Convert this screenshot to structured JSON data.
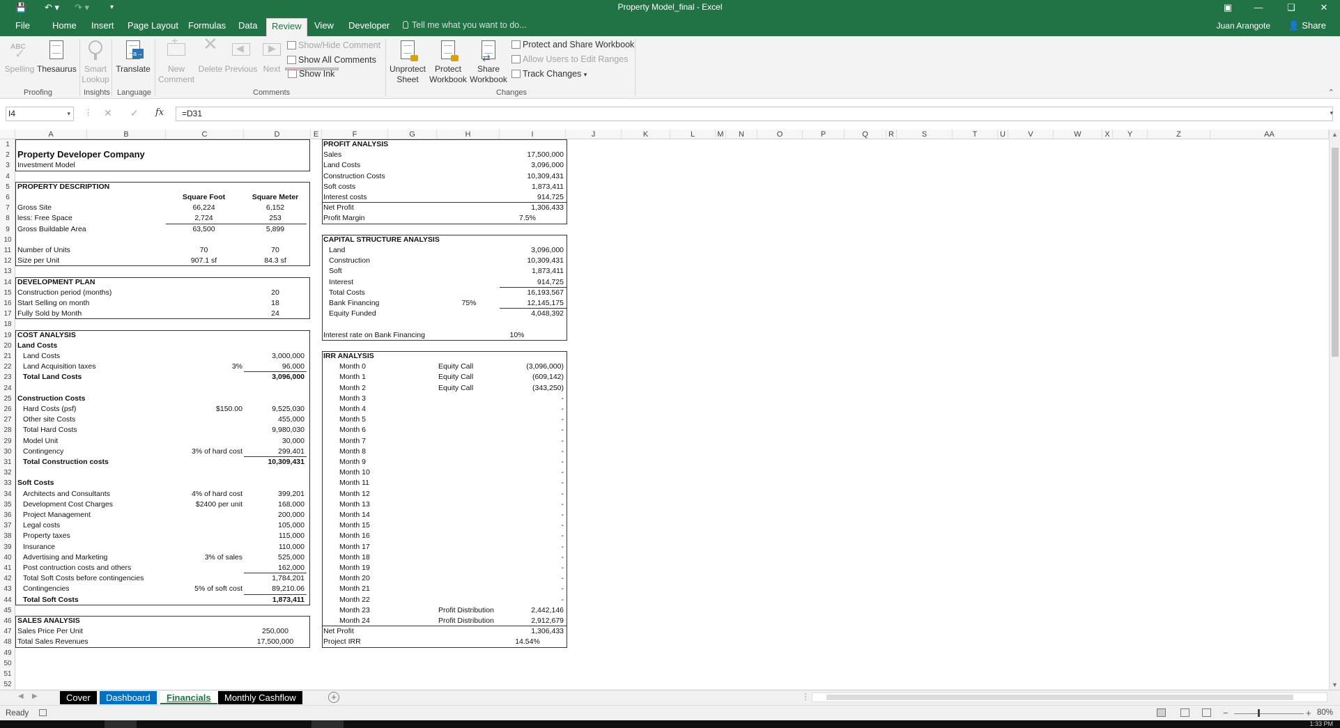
{
  "window": {
    "title": "Property Model_final - Excel",
    "user": "Juan Arangote",
    "share_label": "Share"
  },
  "ribbon_tabs": [
    "File",
    "Home",
    "Insert",
    "Page Layout",
    "Formulas",
    "Data",
    "Review",
    "View",
    "Developer"
  ],
  "active_tab": "Review",
  "tell_me_placeholder": "Tell me what you want to do...",
  "ribbon": {
    "spelling": "Spelling",
    "thesaurus": "Thesaurus",
    "smart_lookup_1": "Smart",
    "smart_lookup_2": "Lookup",
    "translate": "Translate",
    "new_comment_1": "New",
    "new_comment_2": "Comment",
    "delete": "Delete",
    "previous": "Previous",
    "next": "Next",
    "show_hide_comment": "Show/Hide Comment",
    "show_all_comments": "Show All Comments",
    "show_ink": "Show Ink",
    "unprotect_1": "Unprotect",
    "unprotect_2": "Sheet",
    "protect_wb_1": "Protect",
    "protect_wb_2": "Workbook",
    "share_wb_1": "Share",
    "share_wb_2": "Workbook",
    "protect_share": "Protect and Share Workbook",
    "allow_users": "Allow Users to Edit Ranges",
    "track_changes": "Track Changes",
    "groups": {
      "proofing": "Proofing",
      "insights": "Insights",
      "language": "Language",
      "comments": "Comments",
      "changes": "Changes"
    }
  },
  "formula_bar": {
    "name_box": "I4",
    "formula": "=D31",
    "fx": "fx"
  },
  "columns": [
    "A",
    "B",
    "C",
    "D",
    "E",
    "F",
    "G",
    "H",
    "I",
    "J",
    "K",
    "L",
    "M",
    "N",
    "O",
    "P",
    "Q",
    "R",
    "S",
    "T",
    "U",
    "V",
    "W",
    "X",
    "Y",
    "Z",
    "AA"
  ],
  "rows": [
    "1",
    "2",
    "3",
    "4",
    "5",
    "6",
    "7",
    "8",
    "9",
    "10",
    "11",
    "12",
    "13",
    "14",
    "15",
    "16",
    "17",
    "18",
    "19",
    "20",
    "21",
    "22",
    "23",
    "24",
    "25",
    "26",
    "27",
    "28",
    "29",
    "30",
    "31",
    "32",
    "33",
    "34",
    "35",
    "36",
    "37",
    "38",
    "39",
    "40",
    "41",
    "42",
    "43",
    "44",
    "45",
    "46",
    "47",
    "48",
    "49",
    "50",
    "51",
    "52"
  ],
  "sheet": {
    "title": "Property Developer Company",
    "subtitle": "Investment Model",
    "property_description": {
      "header": "PROPERTY DESCRIPTION",
      "col_sqft": "Square Foot",
      "col_sqm": "Square Meter",
      "rows": [
        {
          "label": "Gross Site",
          "sqft": "66,224",
          "sqm": "6,152"
        },
        {
          "label": "less:  Free Space",
          "sqft": "2,724",
          "sqm": "253"
        },
        {
          "label": "Gross Buildable Area",
          "sqft": "63,500",
          "sqm": "5,899"
        }
      ],
      "units_label": "Number of Units",
      "units_sqft": "70",
      "units_sqm": "70",
      "size_label": "Size per Unit",
      "size_sqft": "907.1 sf",
      "size_sqm": "84.3 sf"
    },
    "development_plan": {
      "header": "DEVELOPMENT PLAN",
      "rows": [
        {
          "label": "Construction period (months)",
          "value": "20"
        },
        {
          "label": "Start Selling on month",
          "value": "18"
        },
        {
          "label": "Fully Sold by Month",
          "value": "24"
        }
      ]
    },
    "cost_analysis": {
      "header": "COST ANALYSIS",
      "land_header": "Land Costs",
      "land_rows": [
        {
          "label": "Land Costs",
          "param": "",
          "value": "3,000,000"
        },
        {
          "label": "Land Acquisition taxes",
          "param": "3%",
          "value": "96,000"
        }
      ],
      "land_total_label": "Total Land Costs",
      "land_total": "3,096,000",
      "construction_header": "Construction Costs",
      "construction_rows": [
        {
          "label": "Hard Costs (psf)",
          "param": "$150.00",
          "value": "9,525,030"
        },
        {
          "label": "Other site Costs",
          "param": "",
          "value": "455,000"
        },
        {
          "label": "Total Hard Costs",
          "param": "",
          "value": "9,980,030"
        },
        {
          "label": "Model Unit",
          "param": "",
          "value": "30,000"
        },
        {
          "label": "Contingency",
          "param": "3% of hard cost",
          "value": "299,401"
        }
      ],
      "construction_total_label": "Total Construction costs",
      "construction_total": "10,309,431",
      "soft_header": "Soft Costs",
      "soft_rows": [
        {
          "label": "Architects and Consultants",
          "param": "4% of hard cost",
          "value": "399,201"
        },
        {
          "label": "Development Cost Charges",
          "param": "$2400 per unit",
          "value": "168,000"
        },
        {
          "label": "Project Management",
          "param": "",
          "value": "200,000"
        },
        {
          "label": "Legal costs",
          "param": "",
          "value": "105,000"
        },
        {
          "label": "Property taxes",
          "param": "",
          "value": "115,000"
        },
        {
          "label": "Insurance",
          "param": "",
          "value": "110,000"
        },
        {
          "label": "Advertising and Marketing",
          "param": "3% of sales",
          "value": "525,000"
        },
        {
          "label": "Post contruction costs and others",
          "param": "",
          "value": "162,000"
        },
        {
          "label": "Total Soft Costs before contingencies",
          "param": "",
          "value": "1,784,201"
        },
        {
          "label": "Contingencies",
          "param": "5% of soft cost",
          "value": "89,210.06"
        }
      ],
      "soft_total_label": "Total Soft Costs",
      "soft_total": "1,873,411"
    },
    "sales_analysis": {
      "header": "SALES ANALYSIS",
      "rows": [
        {
          "label": "Sales Price Per Unit",
          "value": "250,000"
        },
        {
          "label": "Total Sales Revenues",
          "value": "17,500,000"
        }
      ]
    },
    "profit_analysis": {
      "header": "PROFIT ANALYSIS",
      "rows": [
        {
          "label": "Sales",
          "value": "17,500,000"
        },
        {
          "label": "Land Costs",
          "value": "3,096,000"
        },
        {
          "label": "Construction Costs",
          "value": "10,309,431"
        },
        {
          "label": "Soft costs",
          "value": "1,873,411"
        },
        {
          "label": "Interest costs",
          "value": "914,725"
        },
        {
          "label": "Net Profit",
          "value": "1,306,433"
        },
        {
          "label": "Profit Margin",
          "value": "7.5%"
        }
      ]
    },
    "capital_structure": {
      "header": "CAPITAL STRUCTURE ANALYSIS",
      "rows": [
        {
          "label": "Land",
          "param": "",
          "value": "3,096,000"
        },
        {
          "label": "Construction",
          "param": "",
          "value": "10,309,431"
        },
        {
          "label": "Soft",
          "param": "",
          "value": "1,873,411"
        },
        {
          "label": "Interest",
          "param": "",
          "value": "914,725"
        },
        {
          "label": "Total Costs",
          "param": "",
          "value": "16,193,567"
        },
        {
          "label": "Bank Financing",
          "param": "75%",
          "value": "12,145,175"
        },
        {
          "label": "Equity Funded",
          "param": "",
          "value": "4,048,392"
        }
      ],
      "interest_label": "Interest rate on Bank Financing",
      "interest_value": "10%"
    },
    "irr_analysis": {
      "header": "IRR ANALYSIS",
      "rows": [
        {
          "label": "Month 0",
          "type": "Equity Call",
          "value": "(3,096,000)"
        },
        {
          "label": "Month 1",
          "type": "Equity Call",
          "value": "(609,142)"
        },
        {
          "label": "Month 2",
          "type": "Equity Call",
          "value": "(343,250)"
        },
        {
          "label": "Month 3",
          "type": "",
          "value": "-"
        },
        {
          "label": "Month 4",
          "type": "",
          "value": "-"
        },
        {
          "label": "Month 5",
          "type": "",
          "value": "-"
        },
        {
          "label": "Month 6",
          "type": "",
          "value": "-"
        },
        {
          "label": "Month 7",
          "type": "",
          "value": "-"
        },
        {
          "label": "Month 8",
          "type": "",
          "value": "-"
        },
        {
          "label": "Month 9",
          "type": "",
          "value": "-"
        },
        {
          "label": "Month 10",
          "type": "",
          "value": "-"
        },
        {
          "label": "Month 11",
          "type": "",
          "value": "-"
        },
        {
          "label": "Month 12",
          "type": "",
          "value": "-"
        },
        {
          "label": "Month 13",
          "type": "",
          "value": "-"
        },
        {
          "label": "Month 14",
          "type": "",
          "value": "-"
        },
        {
          "label": "Month 15",
          "type": "",
          "value": "-"
        },
        {
          "label": "Month 16",
          "type": "",
          "value": "-"
        },
        {
          "label": "Month 17",
          "type": "",
          "value": "-"
        },
        {
          "label": "Month 18",
          "type": "",
          "value": "-"
        },
        {
          "label": "Month 19",
          "type": "",
          "value": "-"
        },
        {
          "label": "Month 20",
          "type": "",
          "value": "-"
        },
        {
          "label": "Month 21",
          "type": "",
          "value": "-"
        },
        {
          "label": "Month 22",
          "type": "",
          "value": "-"
        },
        {
          "label": "Month 23",
          "type": "Profit Distribution",
          "value": "2,442,146"
        },
        {
          "label": "Month 24",
          "type": "Profit Distribution",
          "value": "2,912,679"
        }
      ],
      "net_profit_label": "Net Profit",
      "net_profit": "1,306,433",
      "irr_label": "Project IRR",
      "irr": "14.54%"
    }
  },
  "sheet_tabs": [
    {
      "label": "Cover",
      "bg": "#000000",
      "fg": "#ffffff"
    },
    {
      "label": "Dashboard",
      "bg": "#0070c0",
      "fg": "#ffffff"
    },
    {
      "label": "Financials",
      "bg": "#ffffff",
      "fg": "#217346"
    },
    {
      "label": "Monthly Cashflow",
      "bg": "#000000",
      "fg": "#ffffff"
    }
  ],
  "status": {
    "ready": "Ready",
    "zoom": "80%",
    "time": "1:33 PM"
  },
  "colors": {
    "excel_green": "#217346"
  }
}
